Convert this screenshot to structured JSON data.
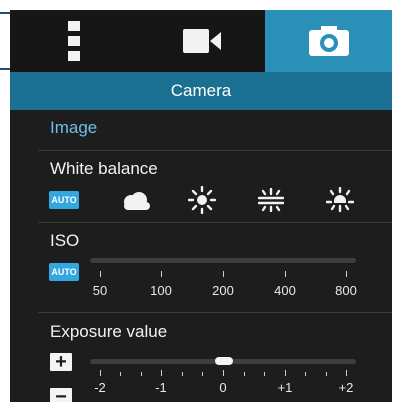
{
  "tabs": [
    {
      "name": "more-options",
      "icon": "vertical-dots-icon",
      "active": false
    },
    {
      "name": "video",
      "icon": "video-camera-icon",
      "active": false
    },
    {
      "name": "camera",
      "icon": "camera-icon",
      "active": true
    }
  ],
  "header": {
    "title": "Camera"
  },
  "image_section": {
    "heading": "Image"
  },
  "white_balance": {
    "label": "White balance",
    "auto_label": "AUTO",
    "options": [
      "auto",
      "cloudy-icon",
      "daylight-icon",
      "fluorescent-icon",
      "incandescent-icon"
    ],
    "selected": "auto"
  },
  "iso": {
    "label": "ISO",
    "auto_label": "AUTO",
    "values": [
      "50",
      "100",
      "200",
      "400",
      "800"
    ]
  },
  "exposure": {
    "label": "Exposure value",
    "values": [
      "-2",
      "-1",
      "0",
      "+1",
      "+2"
    ],
    "current": "0",
    "plus_label": "+",
    "minus_label": "−"
  },
  "colors": {
    "accent": "#33a7e0",
    "header": "#1b6f91",
    "active_tab": "#2a90b8",
    "section_heading": "#6cc0e6",
    "background": "#1d1d1d"
  }
}
